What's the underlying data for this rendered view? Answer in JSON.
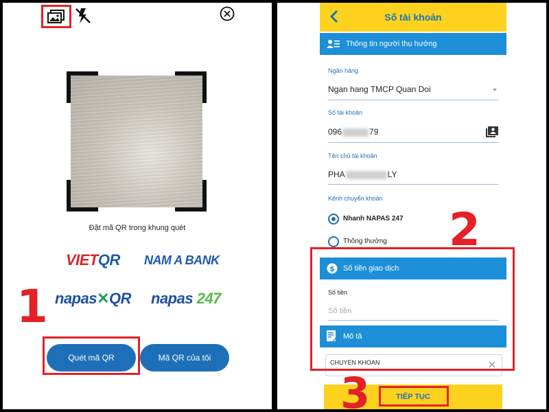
{
  "left": {
    "scan_hint": "Đặt mã QR trong khung quét",
    "logos": {
      "vietqr_a": "VIET",
      "vietqr_b": "QR",
      "namabank": "NAM A BANK",
      "napas_a": "napas",
      "napas_x": "✕",
      "napas_b": "QR",
      "napas247_a": "napas ",
      "napas247_b": "247"
    },
    "scan_button": "Quét mã QR",
    "my_qr_button": "Mã QR của tôi",
    "step_number": "1"
  },
  "right": {
    "title": "Số tài khoản",
    "beneficiary_section": "Thông tin người thụ hưởng",
    "bank_label": "Ngân hàng",
    "bank_value": "Ngan hang TMCP Quan Doi",
    "account_label": "Số tài khoản",
    "account_prefix": "096",
    "account_suffix": "79",
    "holder_label": "Tên chủ tài khoản",
    "holder_prefix": "PHA",
    "holder_suffix": "LY",
    "channel_label": "Kênh chuyển khoản",
    "channel_options": [
      "Nhanh NAPAS 247",
      "Thông thường"
    ],
    "amount_section": "Số tiền giao dịch",
    "amount_label": "Số tiền",
    "amount_placeholder": "Số tiền",
    "desc_section": "Mô tả",
    "desc_value": "CHUYEN KHOAN",
    "continue_button": "TIẾP TỤC",
    "step_number_2": "2",
    "step_number_3": "3"
  },
  "colors": {
    "highlight": "#e52026",
    "primary_blue": "#1d70b8",
    "header_yellow": "#fcd21f"
  }
}
